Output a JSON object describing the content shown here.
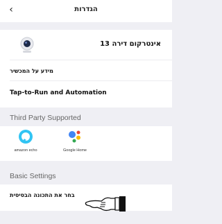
{
  "header": {
    "back_icon": "‹",
    "title": "הגדרות"
  },
  "device": {
    "icon": "camera-icon",
    "name": "אינטרקום דירה 13"
  },
  "rows": {
    "device_info": "מידע על המכשיר",
    "tap_to_run": "Tap-to-Run and Automation"
  },
  "third_party": {
    "title": "Third Party Supported",
    "alexa_label": "amazon echo",
    "google_label": "Google Home"
  },
  "basic": {
    "title": "Basic Settings",
    "row_label": "בחר את התכונה הבסיסית",
    "pointer_icon": "pointing-hand-icon"
  },
  "colors": {
    "alexa_blue": "#31c4f3",
    "google_blue": "#4285f4",
    "google_red": "#ea4335",
    "google_yellow": "#fbbc05",
    "google_green": "#34a853"
  }
}
